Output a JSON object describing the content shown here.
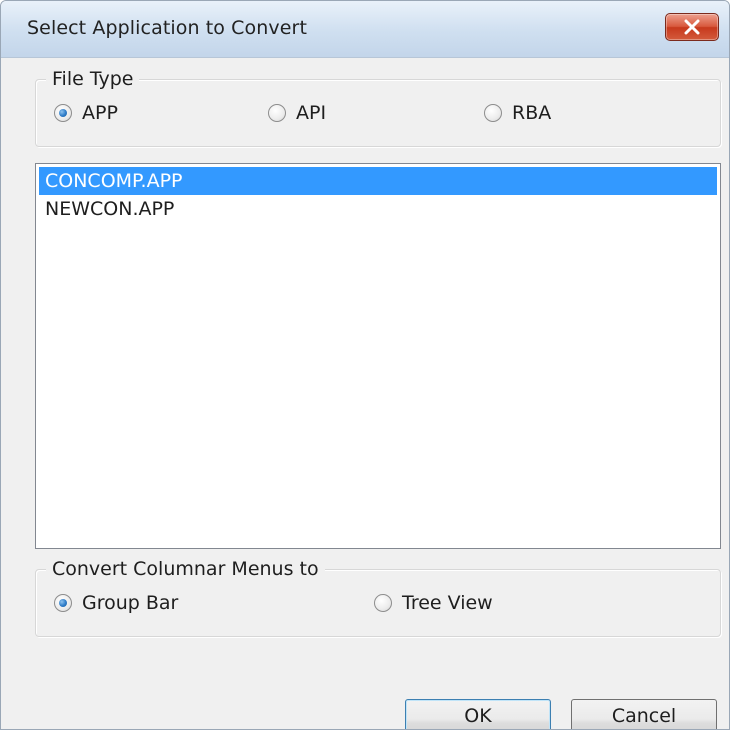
{
  "window": {
    "title": "Select Application to Convert"
  },
  "file_type": {
    "legend": "File Type",
    "options": [
      {
        "label": "APP",
        "checked": true
      },
      {
        "label": "API",
        "checked": false
      },
      {
        "label": "RBA",
        "checked": false
      }
    ]
  },
  "application_list": {
    "items": [
      {
        "label": "CONCOMP.APP",
        "selected": true
      },
      {
        "label": "NEWCON.APP",
        "selected": false
      }
    ]
  },
  "convert_menus": {
    "legend": "Convert Columnar Menus to",
    "options": [
      {
        "label": "Group Bar",
        "checked": true
      },
      {
        "label": "Tree View",
        "checked": false
      }
    ]
  },
  "buttons": {
    "ok_label": "OK",
    "cancel_label": "Cancel"
  },
  "colors": {
    "selection": "#3399ff",
    "titlebar": "#cfdff0",
    "close_button": "#c7391d",
    "dialog_background": "#f0f0f0"
  },
  "icons": {
    "close": "close-x-icon"
  }
}
